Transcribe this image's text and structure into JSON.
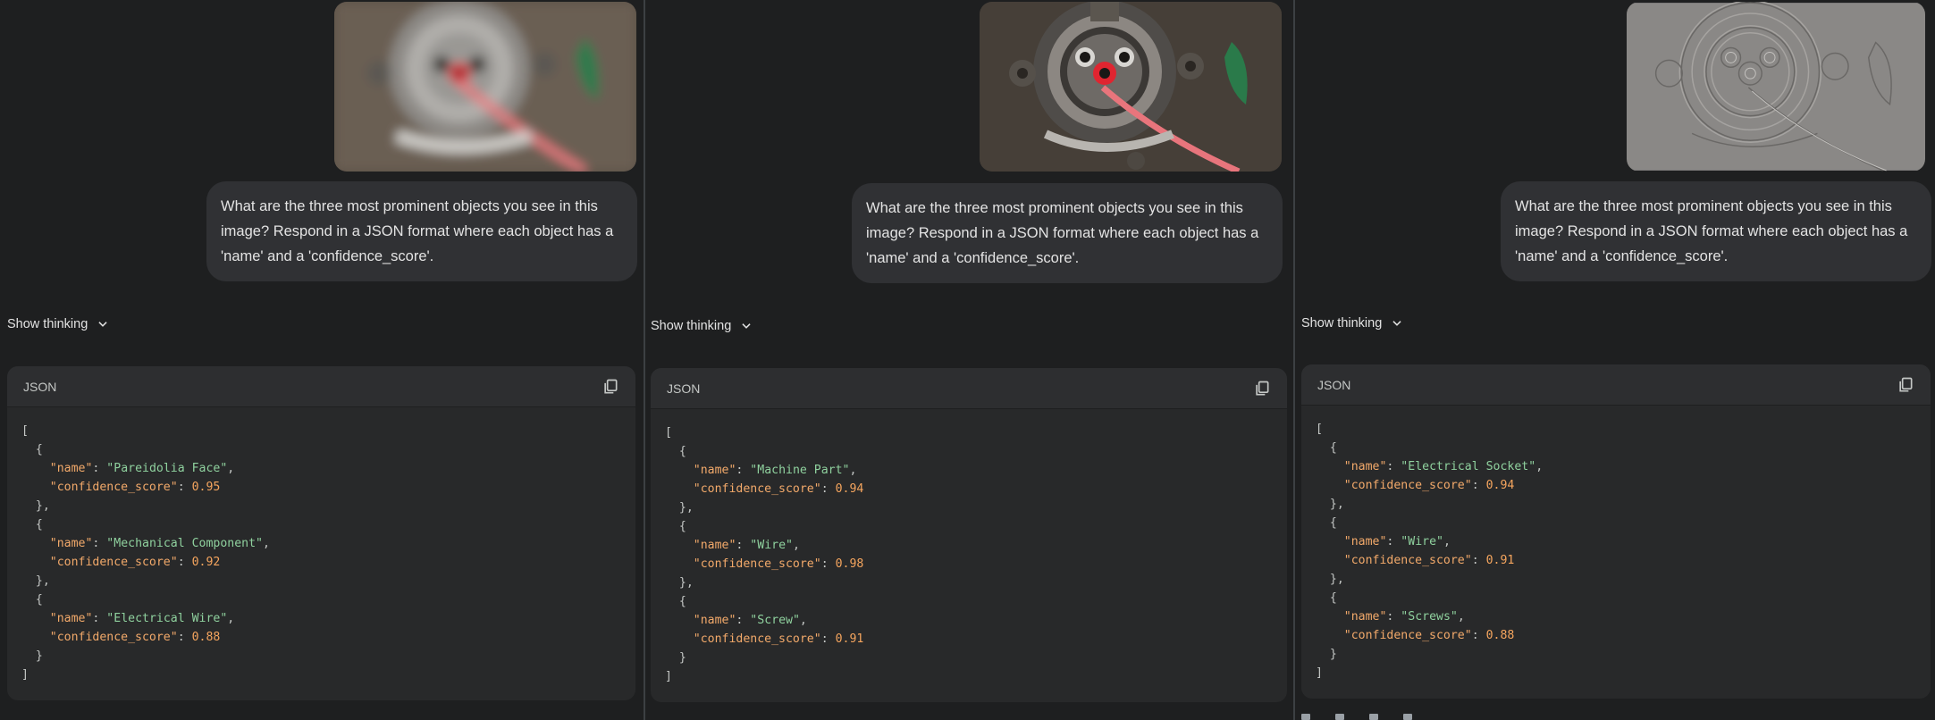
{
  "panels": [
    {
      "prompt": "What are the three most prominent objects you see in this image? Respond in a JSON format where each object has a 'name' and a 'confidence_score'.",
      "thinking_label": "Show thinking",
      "code_lang": "JSON",
      "items": [
        {
          "name": "Pareidolia Face",
          "confidence_score": "0.95"
        },
        {
          "name": "Mechanical Component",
          "confidence_score": "0.92"
        },
        {
          "name": "Electrical Wire",
          "confidence_score": "0.88"
        }
      ],
      "image_style": "blurred"
    },
    {
      "prompt": "What are the three most prominent objects you see in this image? Respond in a JSON format where each object has a 'name' and a 'confidence_score'.",
      "thinking_label": "Show thinking",
      "code_lang": "JSON",
      "items": [
        {
          "name": "Machine Part",
          "confidence_score": "0.94"
        },
        {
          "name": "Wire",
          "confidence_score": "0.98"
        },
        {
          "name": "Screw",
          "confidence_score": "0.91"
        }
      ],
      "image_style": "original"
    },
    {
      "prompt": "What are the three most prominent objects you see in this image? Respond in a JSON format where each object has a 'name' and a 'confidence_score'.",
      "thinking_label": "Show thinking",
      "code_lang": "JSON",
      "items": [
        {
          "name": "Electrical Socket",
          "confidence_score": "0.94"
        },
        {
          "name": "Wire",
          "confidence_score": "0.91"
        },
        {
          "name": "Screws",
          "confidence_score": "0.88"
        }
      ],
      "image_style": "edge-filtered"
    }
  ],
  "icons": {
    "copy": "copy-icon",
    "chevron": "chevron-down-icon"
  },
  "colors": {
    "background": "#1e1f20",
    "bubble": "#303134",
    "code_bg": "#28292a",
    "key": "#f2a96a",
    "string": "#8fd19e",
    "number": "#f5a55e"
  }
}
